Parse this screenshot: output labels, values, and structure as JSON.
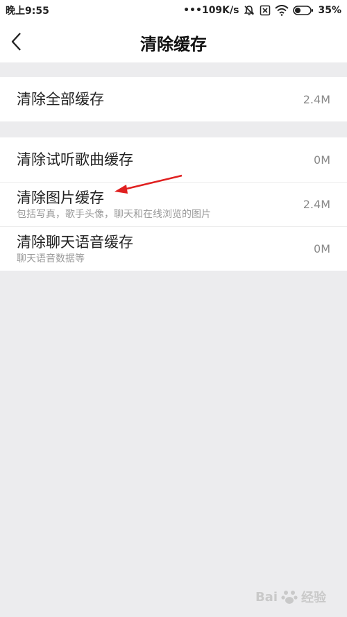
{
  "status_bar": {
    "time": "晚上9:55",
    "network_speed": "•••109K/s",
    "battery": "35%",
    "icons": [
      "mute-icon",
      "sim-off-icon",
      "wifi-icon",
      "battery-icon"
    ]
  },
  "nav": {
    "title": "清除缓存",
    "back_icon": "back-chevron-icon"
  },
  "sections": [
    {
      "rows": [
        {
          "title": "清除全部缓存",
          "value": "2.4M"
        }
      ]
    },
    {
      "rows": [
        {
          "title": "清除试听歌曲缓存",
          "value": "0M"
        },
        {
          "title": "清除图片缓存",
          "subtitle": "包括写真，歌手头像，聊天和在线浏览的图片",
          "value": "2.4M"
        },
        {
          "title": "清除聊天语音缓存",
          "subtitle": "聊天语音数据等",
          "value": "0M"
        }
      ]
    }
  ],
  "annotation": {
    "color": "#e02020"
  },
  "watermark": {
    "text": "Bai",
    "text2": "经验"
  }
}
